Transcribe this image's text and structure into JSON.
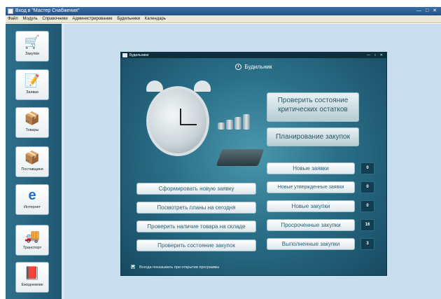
{
  "window": {
    "title": "Вход в \"Мастер Снабжения\"",
    "controls": "— □ ✕"
  },
  "menu": [
    "Файл",
    "Модуль",
    "Справочники",
    "Администрирование",
    "Будильники",
    "Календарь"
  ],
  "sidebar": {
    "items": [
      {
        "label": "Закупки",
        "icon": "cart-icon"
      },
      {
        "label": "Заявки",
        "icon": "document-pen-icon"
      },
      {
        "label": "Товары",
        "icon": "boxes-icon"
      },
      {
        "label": "Поставщики",
        "icon": "hand-truck-icon"
      },
      {
        "label": "Интернет",
        "icon": "internet-explorer-icon"
      },
      {
        "label": "Транспорт",
        "icon": "truck-icon"
      },
      {
        "label": "Ежедневник",
        "icon": "book-icon"
      }
    ]
  },
  "dialog": {
    "title": "Будильники",
    "controls": "— ○ ✕",
    "header": "Будильник",
    "top_buttons": {
      "check_critical": "Проверить состояние критических остатков",
      "plan_purchases": "Планирование закупок"
    },
    "left_buttons": [
      "Сформировать новую заявку",
      "Посмотреть планы на сегодня",
      "Проверить наличие товара на складе",
      "Проверить состояние закупок"
    ],
    "status_items": [
      {
        "label": "Новые заявки",
        "count": "0"
      },
      {
        "label": "Новые утвержденные заявки",
        "count": "0"
      },
      {
        "label": "Новые закупки",
        "count": "0"
      },
      {
        "label": "Просроченные закупки",
        "count": "16"
      },
      {
        "label": "Выполненные закупки",
        "count": "3"
      }
    ],
    "footer_checkbox": "Всегда показывать при открытии программы"
  }
}
